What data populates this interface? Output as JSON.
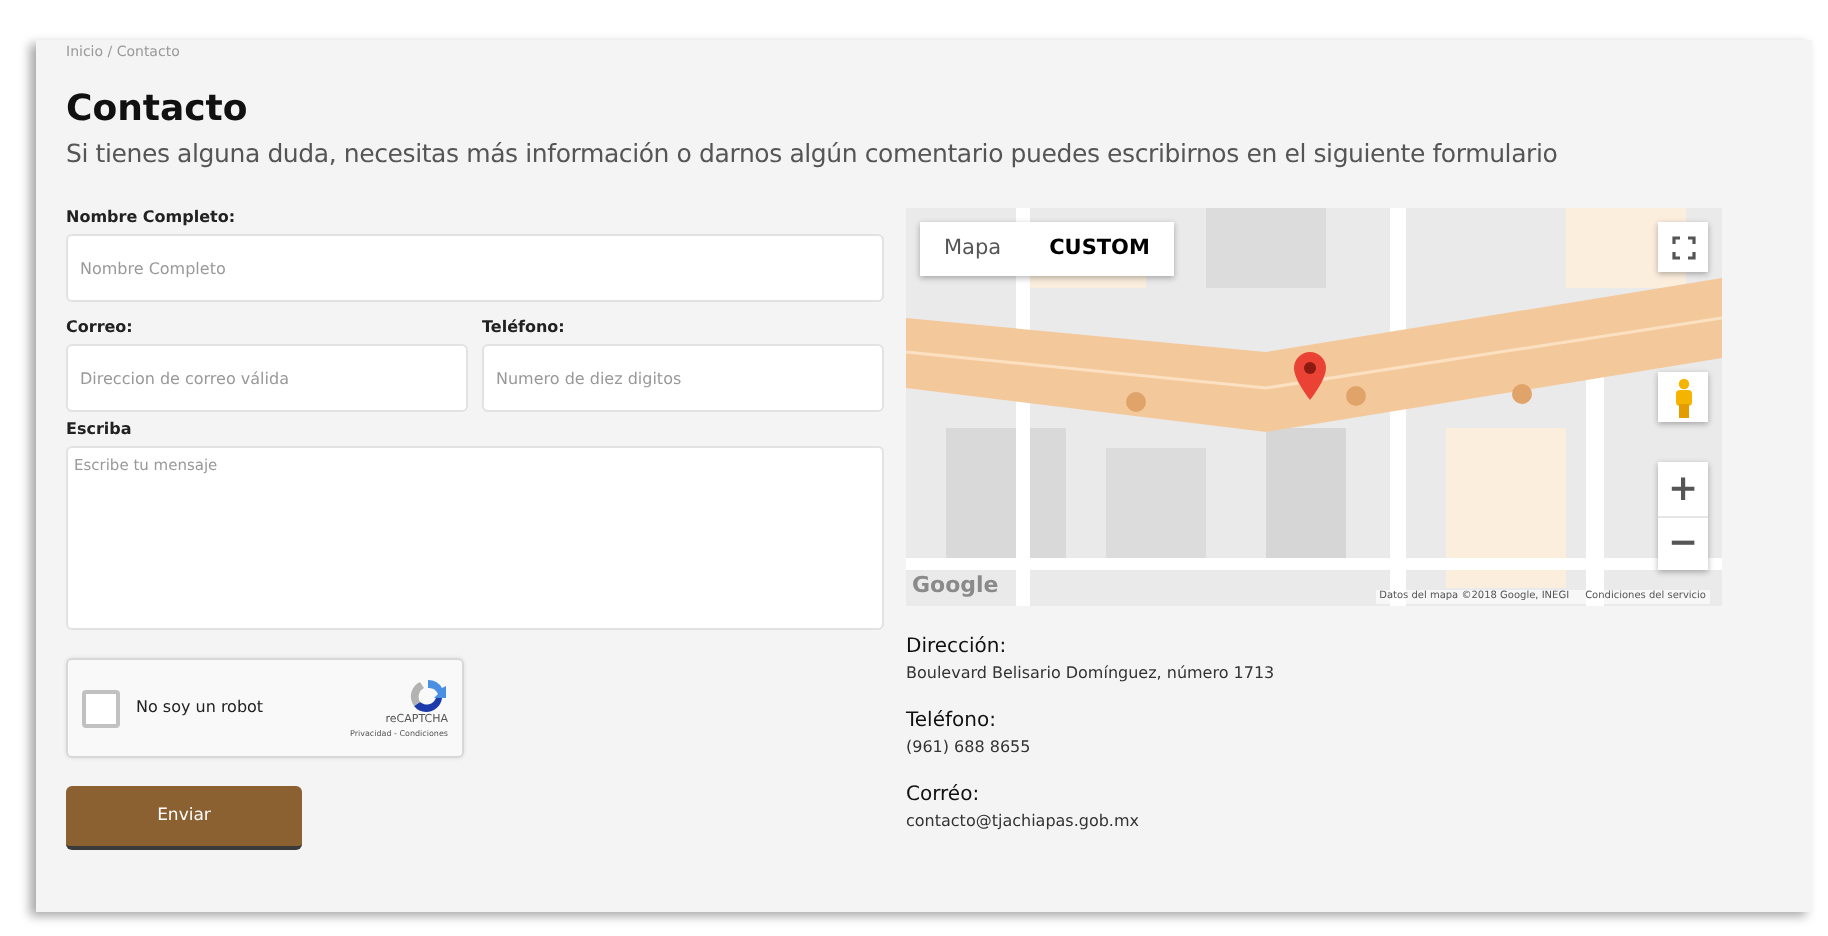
{
  "breadcrumb": "Inicio / Contacto",
  "title": "Contacto",
  "subtitle": "Si tienes alguna duda, necesitas más información o darnos algún comentario puedes escribirnos en el siguiente formulario",
  "form": {
    "fields": [
      {
        "kind": "input",
        "label": "Nombre Completo:",
        "placeholder": "Nombre Completo"
      },
      {
        "kind": "input",
        "label": "Correo:",
        "placeholder": "Direccion de correo válida"
      },
      {
        "kind": "input",
        "label": "Teléfono:",
        "placeholder": "Numero de diez digitos"
      },
      {
        "kind": "textarea",
        "label": "Escriba",
        "placeholder": "Escribe tu mensaje"
      }
    ],
    "captcha": {
      "label": "No soy un robot",
      "checked": false,
      "brand": "reCAPTCHA",
      "links": "Privacidad - Condiciones"
    },
    "submit": "Enviar"
  },
  "map": {
    "tabs": [
      {
        "label": "Mapa",
        "selected": false
      },
      {
        "label": "CUSTOM",
        "selected": true
      }
    ],
    "zoom_in": "+",
    "zoom_out": "−",
    "logo": "Google",
    "attribution": "Datos del mapa ©2018 Google, INEGI",
    "terms": "Condiciones del servicio"
  },
  "contact": [
    {
      "label": "Dirección:",
      "value": "Boulevard Belisario Domínguez, número 1713"
    },
    {
      "label": "Teléfono:",
      "value": "(961) 688 8655"
    },
    {
      "label": "Corréo:",
      "value": "contacto@tjachiapas.gob.mx"
    }
  ]
}
